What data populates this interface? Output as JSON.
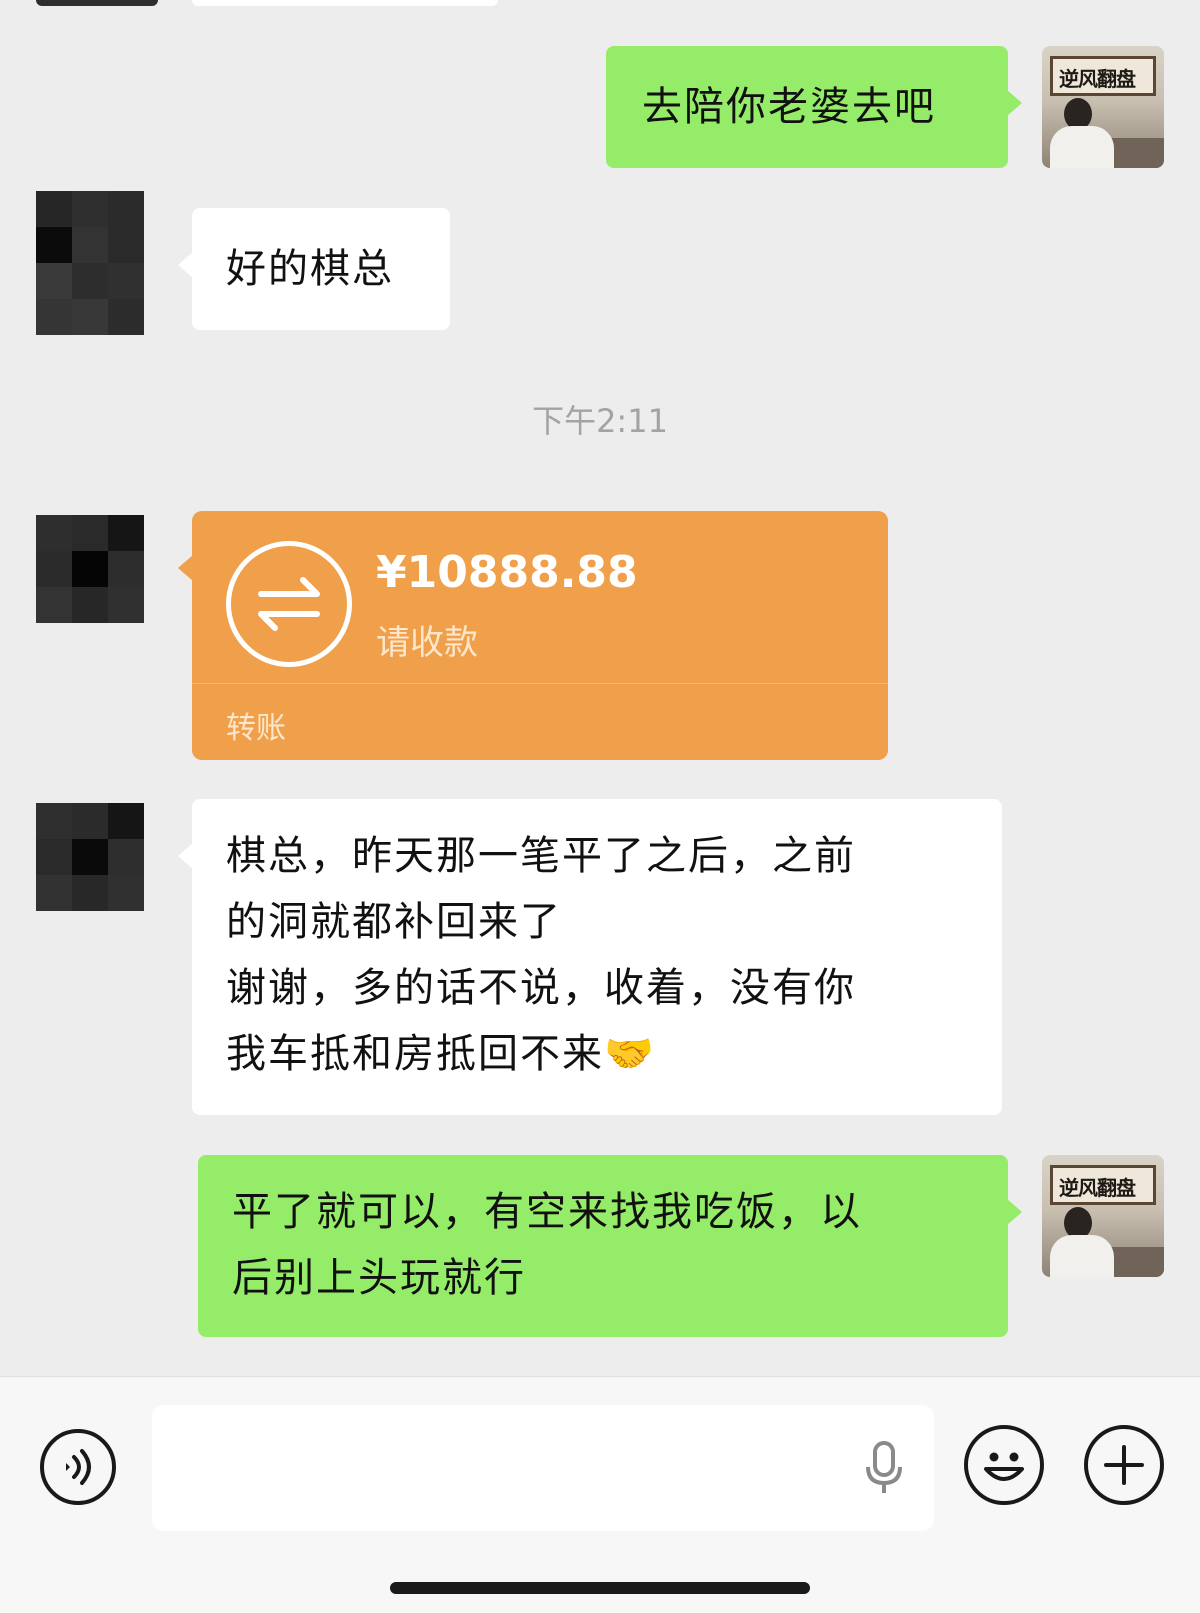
{
  "messages": [
    {
      "sender": "me",
      "text": "去陪你老婆去吧"
    },
    {
      "sender": "other",
      "text": "好的棋总"
    },
    {
      "sender": "other",
      "type": "transfer",
      "amount": "¥10888.88",
      "status": "请收款",
      "label": "转账"
    },
    {
      "sender": "other",
      "lines": [
        "棋总，昨天那一笔平了之后，之前",
        "的洞就都补回来了",
        "谢谢，多的话不说，收着，没有你",
        "我车抵和房抵回不来🤝"
      ]
    },
    {
      "sender": "me",
      "lines": [
        "平了就可以，有空来找我吃饭，以",
        "后别上头玩就行"
      ]
    }
  ],
  "timestamp": "下午2:11",
  "my_avatar": {
    "sign_text": "逆风翻盘"
  },
  "input_bar": {
    "voice_icon": "voice-icon",
    "mic_icon": "microphone-icon",
    "emoji_icon": "emoji-icon",
    "plus_icon": "plus-icon"
  },
  "colors": {
    "my_bubble": "#95ec69",
    "other_bubble": "#ffffff",
    "transfer_card": "#f0a04b",
    "background": "#ededed"
  }
}
